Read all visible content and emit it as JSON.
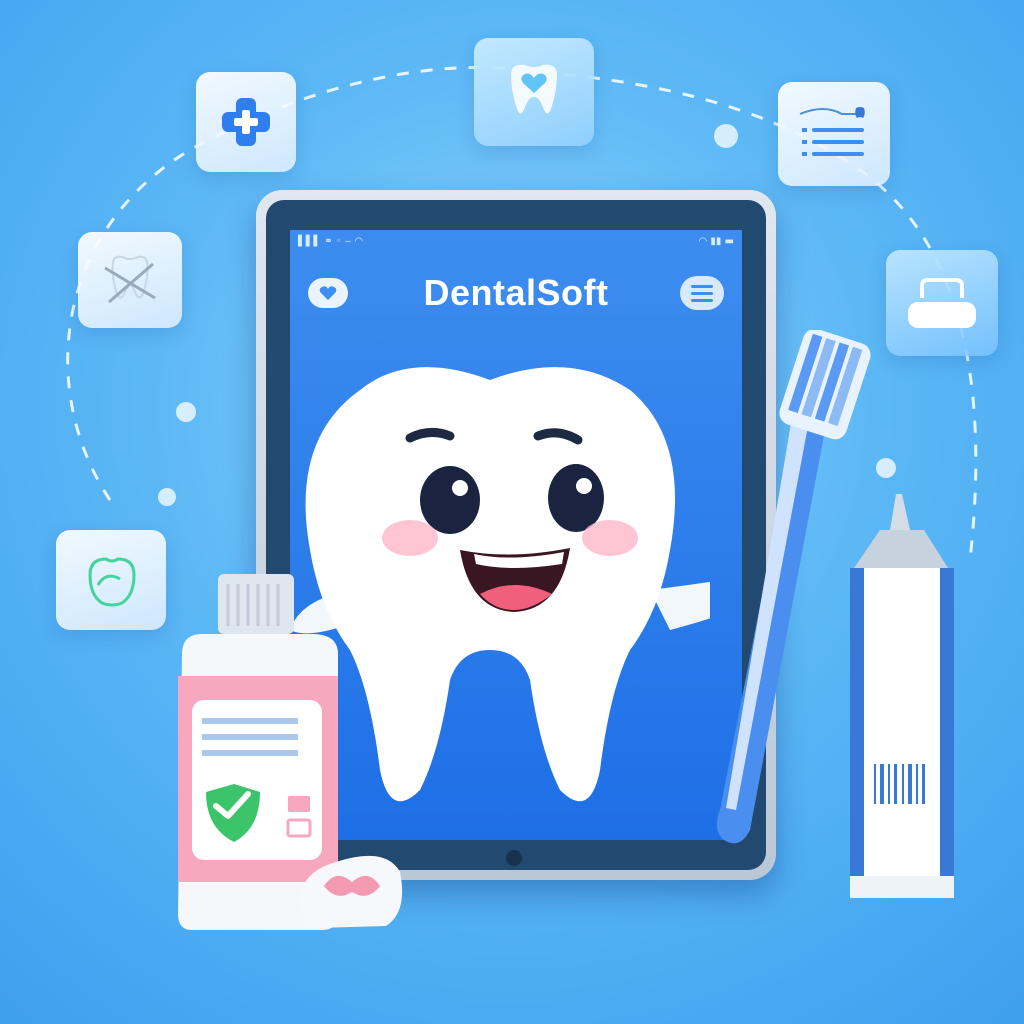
{
  "app": {
    "title": "DentalSoft"
  },
  "colors": {
    "background": "#5cb8f5",
    "screen": "#1e6fe6",
    "tooth": "#ffffff",
    "bottle_label": "#f6a9c0",
    "shield": "#3cc46b"
  },
  "icons": [
    "medical-cross-icon",
    "tooth-heart-icon",
    "dental-record-icon",
    "broken-tooth-icon",
    "dental-chair-icon",
    "gum-care-icon",
    "heart-icon",
    "menu-icon",
    "shield-check-icon"
  ]
}
